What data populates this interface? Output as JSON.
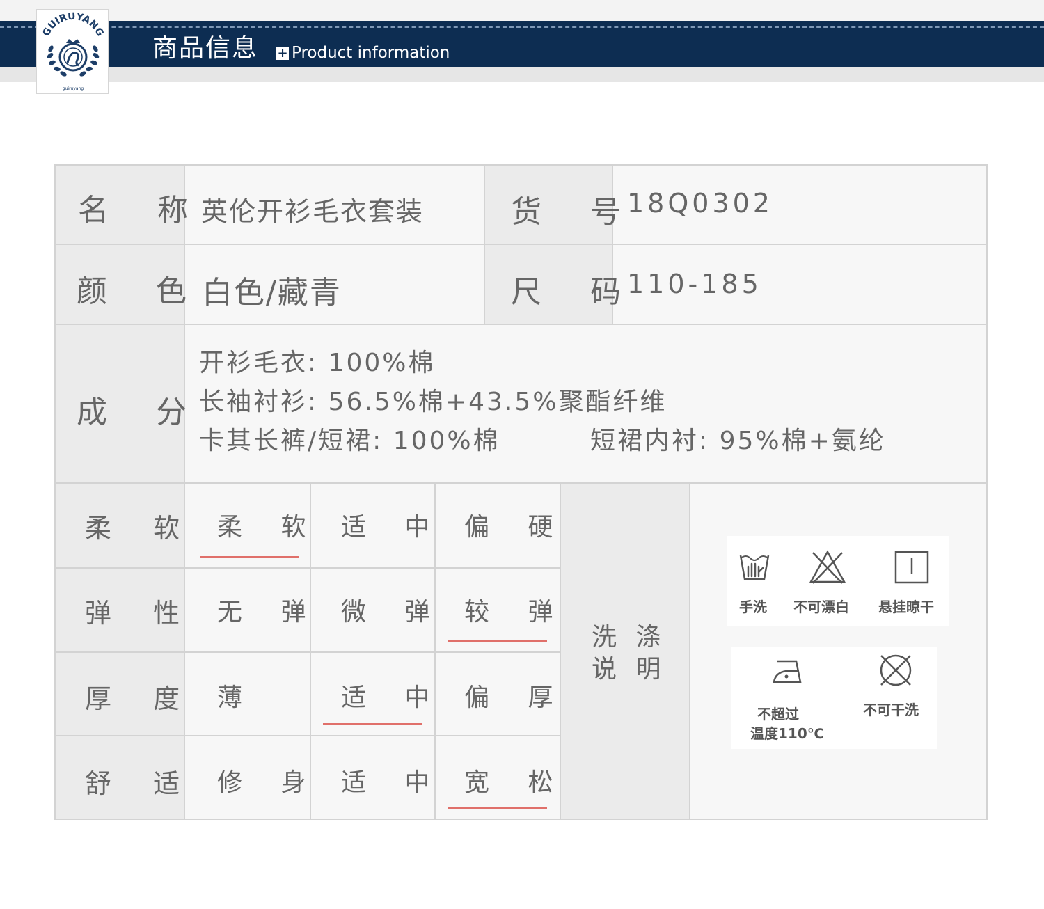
{
  "header": {
    "logo_text": "GUIRUYANG",
    "logo_subtext": "guiruyang",
    "title": "商品信息",
    "subtitle_icon": "plus-square-icon",
    "subtitle": "Product information"
  },
  "table": {
    "name_label": "名 称",
    "name_value": "英伦开衫毛衣套装",
    "item_no_label": "货 号",
    "item_no_value": "18Q0302",
    "color_label": "颜 色",
    "color_value": "白色/藏青",
    "size_label": "尺 码",
    "size_value": "110-185",
    "composition_label": "成 分",
    "composition_lines": [
      "开衫毛衣: 100%棉",
      "长袖衬衫: 56.5%棉+43.5%聚酯纤维",
      "卡其长裤/短裙: 100%棉",
      "短裙内衬: 95%棉+氨纶"
    ],
    "attributes": [
      {
        "label": "柔 软",
        "options": [
          "柔 软",
          "适 中",
          "偏 硬"
        ],
        "selected": 0
      },
      {
        "label": "弹 性",
        "options": [
          "无 弹",
          "微 弹",
          "较 弹"
        ],
        "selected": 2
      },
      {
        "label": "厚 度",
        "options": [
          "薄",
          "适 中",
          "偏 厚"
        ],
        "selected": 1
      },
      {
        "label": "舒 适",
        "options": [
          "修 身",
          "适 中",
          "宽 松"
        ],
        "selected": 2
      }
    ],
    "wash_label_line1": "洗 涤",
    "wash_label_line2": "说 明",
    "wash_icons": [
      {
        "icon": "hand-wash-icon",
        "label": "手洗"
      },
      {
        "icon": "no-bleach-icon",
        "label": "不可漂白"
      },
      {
        "icon": "hang-dry-icon",
        "label": "悬挂晾干"
      },
      {
        "icon": "iron-icon",
        "label_line1": "不超过",
        "label_line2": "温度110℃"
      },
      {
        "icon": "no-dry-clean-icon",
        "label": "不可干洗"
      }
    ],
    "underline_color": "#e0706a"
  }
}
